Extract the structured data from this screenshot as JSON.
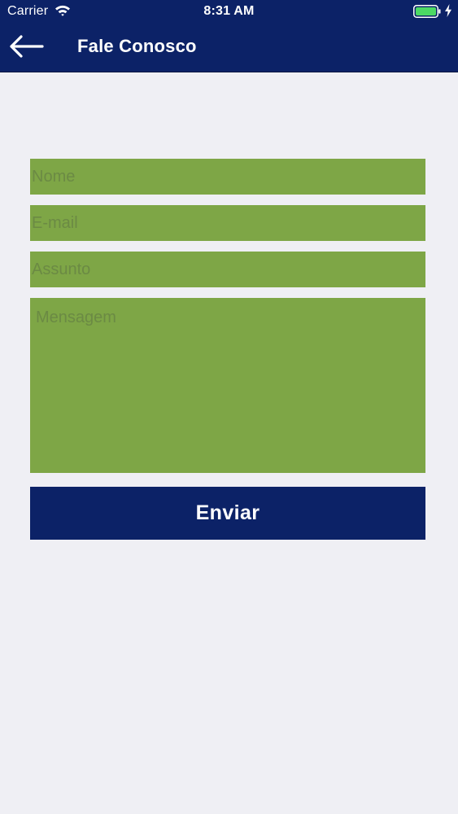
{
  "status_bar": {
    "carrier": "Carrier",
    "time": "8:31 AM",
    "icons": [
      "wifi-icon",
      "battery-icon",
      "charging-bolt-icon"
    ],
    "battery_color": "#4cd964"
  },
  "header": {
    "title": "Fale Conosco",
    "back_icon": "arrow-left-icon",
    "background": "#0c2267"
  },
  "form": {
    "name_placeholder": "Nome",
    "email_placeholder": "E-mail",
    "subject_placeholder": "Assunto",
    "message_placeholder": "Mensagem",
    "field_color": "#7ea646",
    "submit_label": "Enviar",
    "submit_color": "#0c2267"
  }
}
